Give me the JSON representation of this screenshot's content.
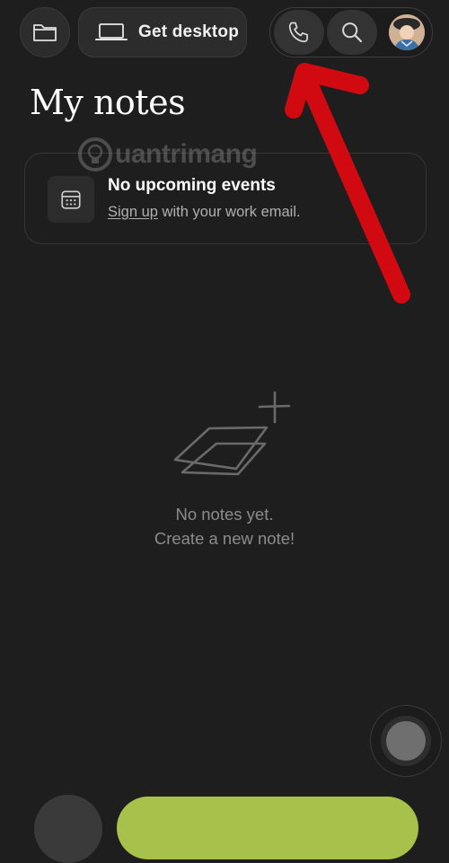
{
  "header": {
    "desktop_label": "Get desktop"
  },
  "title": "My notes",
  "events": {
    "title": "No upcoming events",
    "signup_link": "Sign up",
    "signup_suffix": " with your work email."
  },
  "empty_state": {
    "line1": "No notes yet.",
    "line2": "Create a new note!"
  },
  "watermark": "uantrimang",
  "icons": {
    "folder": "folder-icon",
    "desktop": "laptop-icon",
    "phone": "phone-icon",
    "search": "search-icon",
    "calendar": "calendar-icon"
  },
  "colors": {
    "background": "#1e1e1e",
    "accent_green": "#a8c14a",
    "annotation_red": "#d10a12"
  }
}
